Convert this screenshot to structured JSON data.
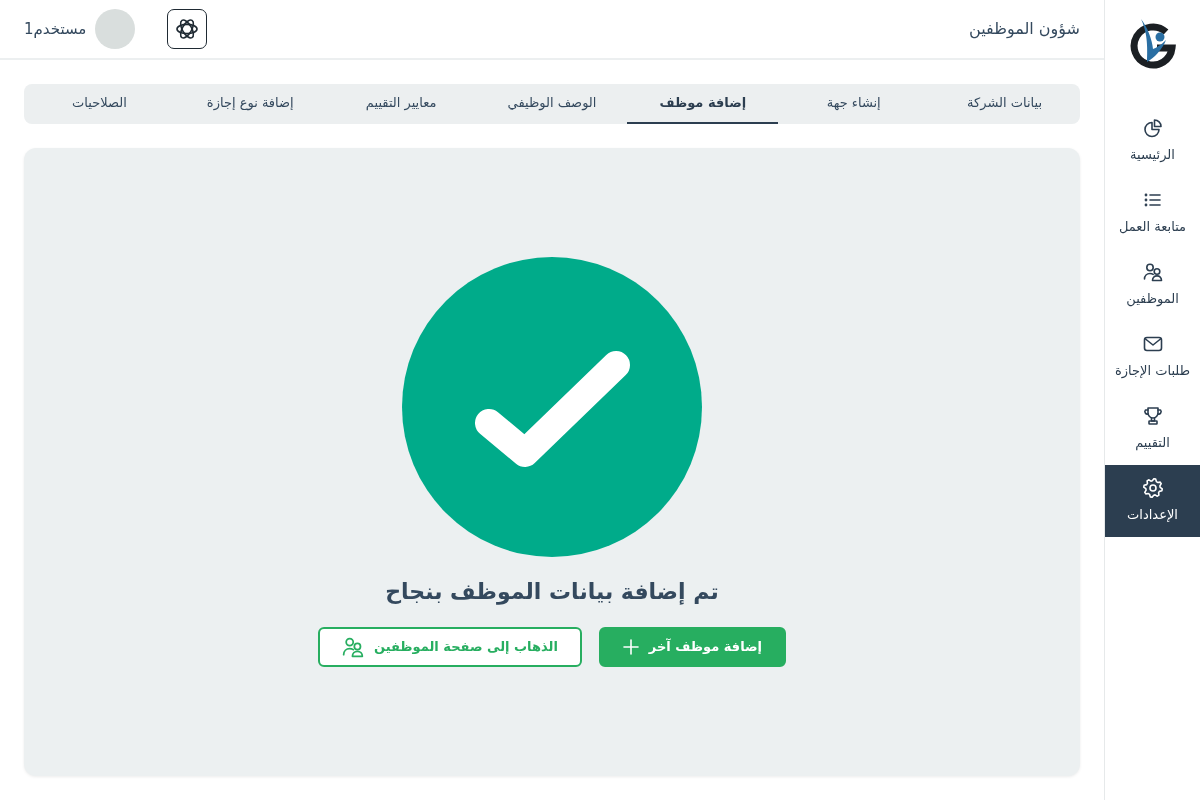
{
  "sidebar": {
    "items": [
      {
        "label": "الرئيسية",
        "selected": false
      },
      {
        "label": "متابعة العمل",
        "selected": false
      },
      {
        "label": "الموظفين",
        "selected": false
      },
      {
        "label": "طلبات الإجازة",
        "selected": false
      },
      {
        "label": "التقييم",
        "selected": false
      },
      {
        "label": "الإعدادات",
        "selected": true
      }
    ]
  },
  "header": {
    "title": "شؤون الموظفين",
    "user_name": "مستخدم1"
  },
  "tabs": [
    {
      "label": "بيانات الشركة",
      "selected": false
    },
    {
      "label": "إنشاء جهة",
      "selected": false
    },
    {
      "label": "إضافة موظف",
      "selected": true
    },
    {
      "label": "الوصف الوظيفي",
      "selected": false
    },
    {
      "label": "معايير التقييم",
      "selected": false
    },
    {
      "label": "إضافة نوع إجازة",
      "selected": false
    },
    {
      "label": "الصلاحيات",
      "selected": false
    }
  ],
  "success": {
    "message": "تم إضافة بيانات الموظف بنجاح",
    "buttons": [
      {
        "label": "إضافة موظف آخر",
        "kind": "primary"
      },
      {
        "label": "الذهاب إلى صفحة الموظفين",
        "kind": "outline"
      }
    ]
  }
}
